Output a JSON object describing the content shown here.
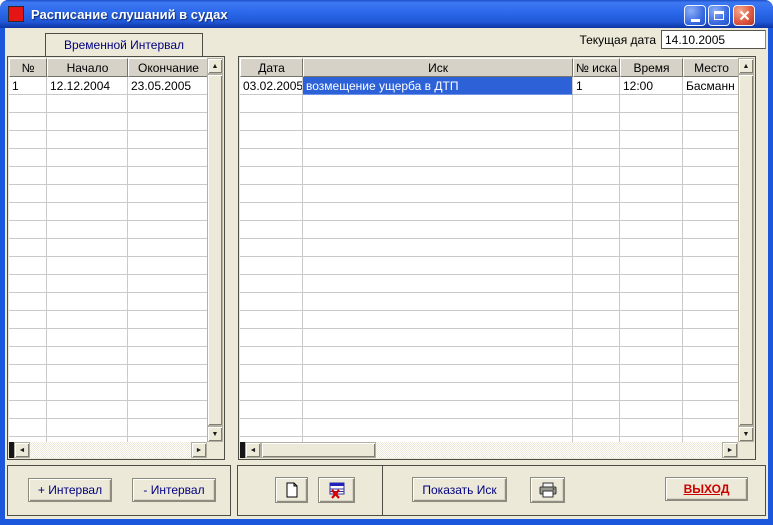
{
  "window": {
    "title": "Расписание слушаний в судах"
  },
  "topbar": {
    "current_date_label": "Текущая дата",
    "current_date_value": "14.10.2005"
  },
  "intervals": {
    "box_title": "Временной Интервал",
    "columns": [
      "№",
      "Начало",
      "Окончание"
    ],
    "rows": [
      [
        "1",
        "12.12.2004",
        "23.05.2005"
      ]
    ],
    "add_button_label": "+ Интервал",
    "remove_button_label": "- Интервал"
  },
  "hearings": {
    "columns": [
      "Дата",
      "Иск",
      "№ иска",
      "Время",
      "Место"
    ],
    "rows": [
      [
        "03.02.2005",
        "возмещение ущерба в ДТП",
        "1",
        "12:00",
        "Басманн"
      ]
    ],
    "selected_row": 0,
    "selected_column": "Иск",
    "show_claim_button_label": "Показать Иск",
    "exit_button_label": "ВЫХОД"
  },
  "glyphs": {
    "up": "▲",
    "down": "▼",
    "left": "◄",
    "right": "►"
  },
  "icons": [
    "red-square-app-icon",
    "minimize-icon",
    "maximize-icon",
    "close-icon",
    "new-document-icon",
    "delete-record-icon",
    "printer-icon"
  ],
  "colors": {
    "selection_blue": "#2c61d8",
    "titlebar_blue": "#2b68ea",
    "client_background": "#ece9d8",
    "accent_navy": "#000080",
    "exit_red": "#cc0000"
  }
}
